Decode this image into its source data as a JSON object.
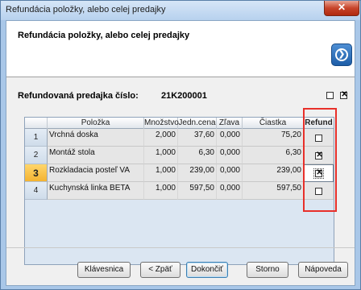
{
  "window": {
    "title": "Refundácia položky, alebo celej predajky",
    "close_glyph": "✕"
  },
  "header": {
    "title": "Refundácia položky, alebo celej predajky",
    "help_icon": "help-arrow-icon"
  },
  "receipt": {
    "label": "Refundovaná predajka číslo:",
    "number": "21K200001"
  },
  "select_all": {
    "uncheck_all": false,
    "check_all": true,
    "check_glyph": "✕"
  },
  "grid": {
    "columns": [
      "Položka",
      "Množstvo",
      "Jedn.cena",
      "Zľava",
      "Čiastka",
      "Refund"
    ],
    "rows": [
      {
        "num": "1",
        "item": "Vrchná doska",
        "qty": "2,000",
        "price": "37,60",
        "discount": "0,000",
        "amount": "75,20",
        "refund": false
      },
      {
        "num": "2",
        "item": "Montáž stola",
        "qty": "1,000",
        "price": "6,30",
        "discount": "0,000",
        "amount": "6,30",
        "refund": true
      },
      {
        "num": "3",
        "item": "Rozkladacia posteľ VA",
        "qty": "1,000",
        "price": "239,00",
        "discount": "0,000",
        "amount": "239,00",
        "refund": true
      },
      {
        "num": "4",
        "item": "Kuchynská linka BETA",
        "qty": "1,000",
        "price": "597,50",
        "discount": "0,000",
        "amount": "597,50",
        "refund": false
      }
    ],
    "active_row": "3"
  },
  "buttons": {
    "keyboard": "Klávesnica",
    "back": "< Zpäť",
    "finish": "Dokončiť",
    "cancel": "Storno",
    "help": "Nápoveda"
  },
  "colors": {
    "highlight_border": "#e8302a",
    "active_row": "#f4b331"
  }
}
